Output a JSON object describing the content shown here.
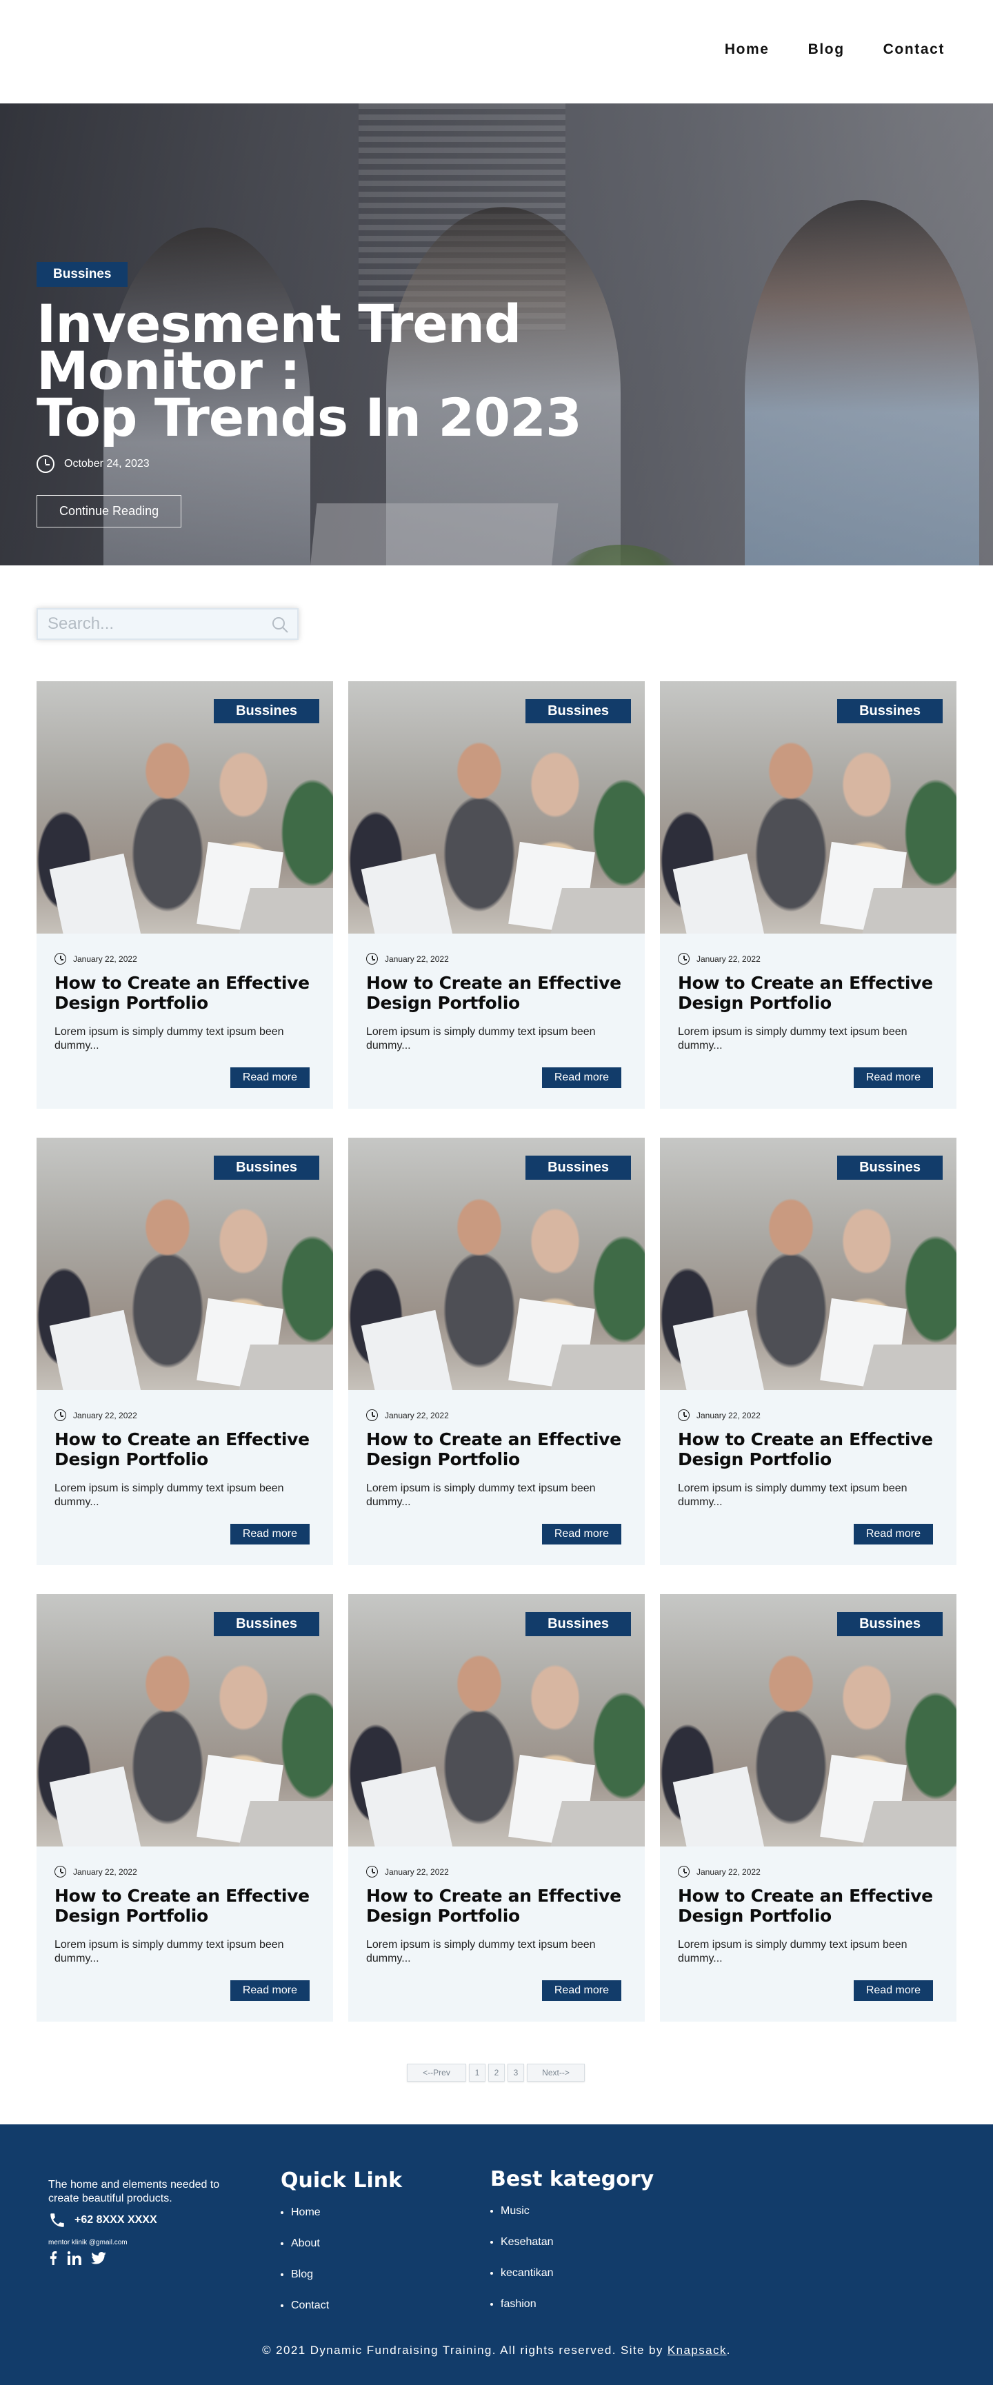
{
  "nav": {
    "items": [
      "Home",
      "Blog",
      "Contact"
    ]
  },
  "hero": {
    "tag": "Bussines",
    "title": "Invesment  Trend Monitor :\nTop Trends In 2023",
    "date": "October 24, 2023",
    "cta": "Continue Reading"
  },
  "search": {
    "placeholder": "Search..."
  },
  "cards": [
    {
      "tag": "Bussines",
      "date": "January 22, 2022",
      "title": "How to Create an Effective Design Portfolio",
      "excerpt": "Lorem ipsum is simply dummy text ipsum been dummy...",
      "button": "Read more"
    },
    {
      "tag": "Bussines",
      "date": "January 22, 2022",
      "title": "How to Create an Effective Design Portfolio",
      "excerpt": "Lorem ipsum is simply dummy text ipsum been dummy...",
      "button": "Read more"
    },
    {
      "tag": "Bussines",
      "date": "January 22, 2022",
      "title": "How to Create an Effective Design Portfolio",
      "excerpt": "Lorem ipsum is simply dummy text ipsum been dummy...",
      "button": "Read more"
    },
    {
      "tag": "Bussines",
      "date": "January 22, 2022",
      "title": "How to Create an Effective Design Portfolio",
      "excerpt": "Lorem ipsum is simply dummy text ipsum been dummy...",
      "button": "Read more"
    },
    {
      "tag": "Bussines",
      "date": "January 22, 2022",
      "title": "How to Create an Effective Design Portfolio",
      "excerpt": "Lorem ipsum is simply dummy text ipsum been dummy...",
      "button": "Read more"
    },
    {
      "tag": "Bussines",
      "date": "January 22, 2022",
      "title": "How to Create an Effective Design Portfolio",
      "excerpt": "Lorem ipsum is simply dummy text ipsum been dummy...",
      "button": "Read more"
    },
    {
      "tag": "Bussines",
      "date": "January 22, 2022",
      "title": "How to Create an Effective Design Portfolio",
      "excerpt": "Lorem ipsum is simply dummy text ipsum been dummy...",
      "button": "Read more"
    },
    {
      "tag": "Bussines",
      "date": "January 22, 2022",
      "title": "How to Create an Effective Design Portfolio",
      "excerpt": "Lorem ipsum is simply dummy text ipsum been dummy...",
      "button": "Read more"
    },
    {
      "tag": "Bussines",
      "date": "January 22, 2022",
      "title": "How to Create an Effective Design Portfolio",
      "excerpt": "Lorem ipsum is simply dummy text ipsum been dummy...",
      "button": "Read more"
    }
  ],
  "pagination": {
    "prev": "<--Prev",
    "pages": [
      "1",
      "2",
      "3"
    ],
    "next": "Next-->"
  },
  "footer": {
    "about": "The home and elements needed to create beautiful products.",
    "phone": "+62 8XXX XXXX",
    "email": "mentor klinik @gmail.com",
    "social": [
      "facebook-icon",
      "linkedin-icon",
      "twitter-icon"
    ],
    "quick_link": {
      "title": "Quick Link",
      "items": [
        "Home",
        "About",
        "Blog",
        "Contact"
      ]
    },
    "best_category": {
      "title": "Best kategory",
      "items": [
        "Music",
        "Kesehatan",
        "kecantikan",
        "fashion"
      ]
    },
    "copyright": "© 2021 Dynamic Fundraising Training. All rights reserved. Site by ",
    "credit_link": "Knapsack",
    "copyright_end": "."
  },
  "colors": {
    "primary": "#123c6a",
    "card_bg": "#f1f6f9",
    "white": "#ffffff"
  }
}
